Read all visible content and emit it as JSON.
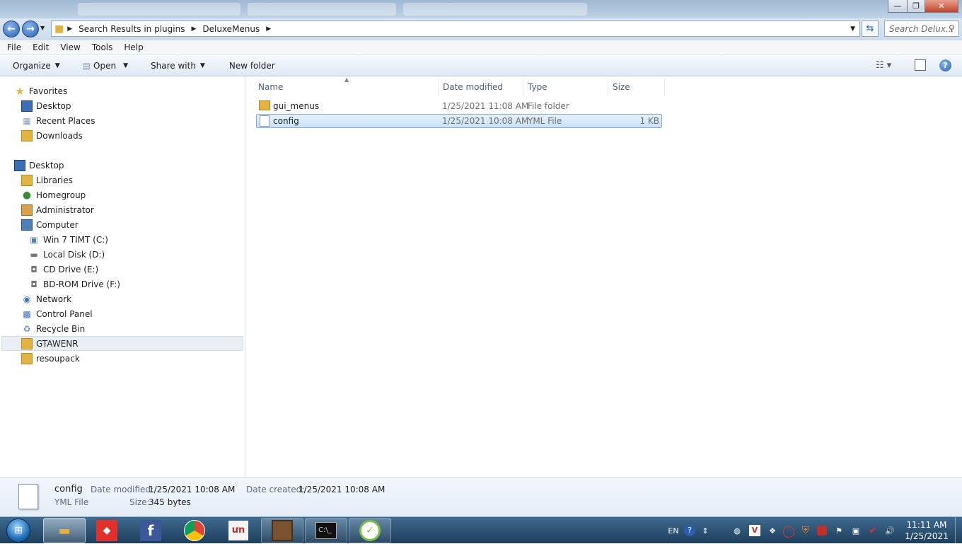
{
  "window": {
    "controls": {
      "minimize": "—",
      "maximize": "❐",
      "close": "✕"
    }
  },
  "address": {
    "crumbs": [
      "Search Results in plugins",
      "DeluxeMenus"
    ],
    "search_placeholder": "Search Delux..."
  },
  "menu": [
    "File",
    "Edit",
    "View",
    "Tools",
    "Help"
  ],
  "toolbar": {
    "organize": "Organize",
    "open": "Open",
    "share": "Share with",
    "new_folder": "New folder"
  },
  "nav": {
    "favorites": "Favorites",
    "fav_items": [
      "Desktop",
      "Recent Places",
      "Downloads"
    ],
    "desktop": "Desktop",
    "desktop_items": [
      "Libraries",
      "Homegroup",
      "Administrator",
      "Computer"
    ],
    "drives": [
      "Win 7 TIMT (C:)",
      "Local Disk (D:)",
      "CD Drive (E:)",
      "BD-ROM Drive (F:)"
    ],
    "others": [
      "Network",
      "Control Panel",
      "Recycle Bin",
      "GTAWENR",
      "resoupack"
    ]
  },
  "columns": {
    "name": "Name",
    "date": "Date modified",
    "type": "Type",
    "size": "Size"
  },
  "files": [
    {
      "name": "gui_menus",
      "date": "1/25/2021 11:08 AM",
      "type": "File folder",
      "size": ""
    },
    {
      "name": "config",
      "date": "1/25/2021 10:08 AM",
      "type": "YML File",
      "size": "1 KB"
    }
  ],
  "details": {
    "name": "config",
    "kind": "YML File",
    "modified_label": "Date modified:",
    "modified": "1/25/2021 10:08 AM",
    "created_label": "Date created:",
    "created": "1/25/2021 10:08 AM",
    "size_label": "Size:",
    "size": "345 bytes"
  },
  "taskbar": {
    "lang": "EN",
    "time": "11:11 AM",
    "date": "1/25/2021"
  },
  "colors": {
    "accent": "#2a5fb0",
    "selection": "#c9e1f8",
    "taskbar": "#2a4d6e"
  }
}
